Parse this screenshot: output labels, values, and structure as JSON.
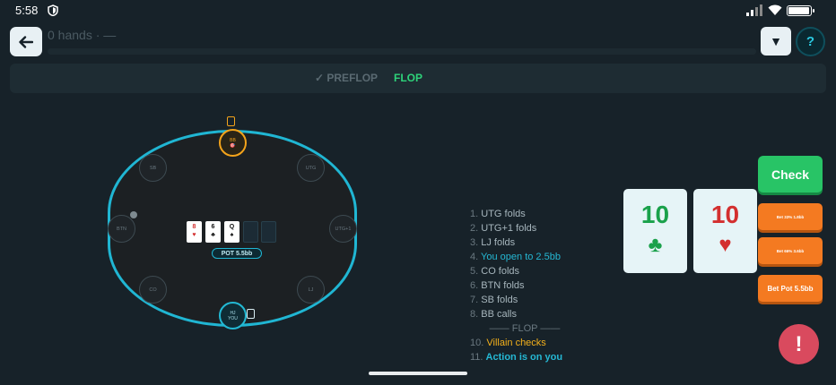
{
  "status_bar": {
    "time": "5:58"
  },
  "header": {
    "hands_label": "0 hands · —",
    "help_label": "?",
    "dropdown_label": "▼"
  },
  "streets": {
    "preflop": "✓ PREFLOP",
    "flop": "FLOP",
    "active": "FLOP"
  },
  "table": {
    "seats": {
      "bb": {
        "line1": "BB",
        "line2": "🎯"
      },
      "sb": "SB",
      "utg": "UTG",
      "btn": "BTN",
      "utg1": "UTG+1",
      "co": "CO",
      "lj": "LJ",
      "hero": {
        "line1": "HJ",
        "line2": "YOU"
      }
    },
    "board": [
      {
        "rank": "8",
        "suit": "♥",
        "color": "red"
      },
      {
        "rank": "6",
        "suit": "♣",
        "color": "black"
      },
      {
        "rank": "Q",
        "suit": "♠",
        "color": "black"
      }
    ],
    "pot": "POT 5.5bb"
  },
  "log": {
    "rows": [
      {
        "num": "1.",
        "text": "UTG folds",
        "style": ""
      },
      {
        "num": "2.",
        "text": "UTG+1 folds",
        "style": ""
      },
      {
        "num": "3.",
        "text": "LJ folds",
        "style": ""
      },
      {
        "num": "4.",
        "text": "You open to 2.5bb",
        "style": "hero"
      },
      {
        "num": "5.",
        "text": "CO folds",
        "style": ""
      },
      {
        "num": "6.",
        "text": "BTN folds",
        "style": ""
      },
      {
        "num": "7.",
        "text": "SB folds",
        "style": ""
      },
      {
        "num": "8.",
        "text": "BB calls",
        "style": ""
      }
    ],
    "divider": "—— FLOP ——",
    "flop_rows": [
      {
        "num": "10.",
        "text": "Villain checks",
        "style": "villain"
      },
      {
        "num": "11.",
        "text": "Action is on you",
        "style": "action"
      }
    ]
  },
  "hole_cards": [
    {
      "rank": "10",
      "suit": "♣",
      "color": "#1aa14b"
    },
    {
      "rank": "10",
      "suit": "♥",
      "color": "#d32f2f"
    }
  ],
  "actions": {
    "check": "Check",
    "bet_33": "Bet 33% 1.8bb",
    "bet_66": "Bet 66% 3.6bb",
    "bet_pot": "Bet Pot 5.5bb"
  },
  "report_label": "!",
  "colors": {
    "accent": "#20b6d3",
    "check": "#28c466",
    "bet": "#f47a21",
    "villain": "#f3a31b",
    "report": "#d94a5e"
  }
}
